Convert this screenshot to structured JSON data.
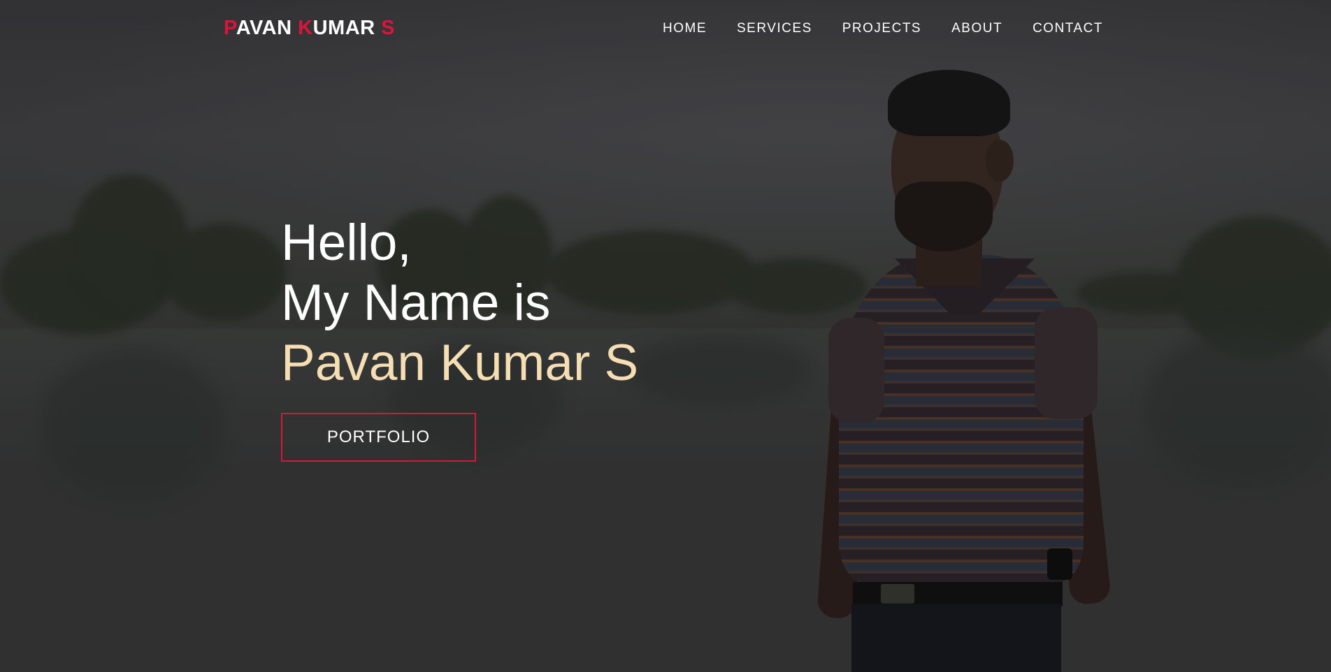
{
  "colors": {
    "accent": "#dc143c",
    "name_highlight": "#f5deb3",
    "text": "#ffffff"
  },
  "logo": {
    "parts": [
      {
        "text": "P",
        "accent": true
      },
      {
        "text": "AVAN ",
        "accent": false
      },
      {
        "text": "K",
        "accent": true
      },
      {
        "text": "UMAR ",
        "accent": false
      },
      {
        "text": "S",
        "accent": true
      }
    ]
  },
  "nav": {
    "items": [
      "HOME",
      "SERVICES",
      "PROJECTS",
      "ABOUT",
      "CONTACT"
    ]
  },
  "hero": {
    "line1": "Hello,",
    "line2": "My Name is",
    "name": "Pavan Kumar S",
    "button_label": "PORTFOLIO"
  }
}
